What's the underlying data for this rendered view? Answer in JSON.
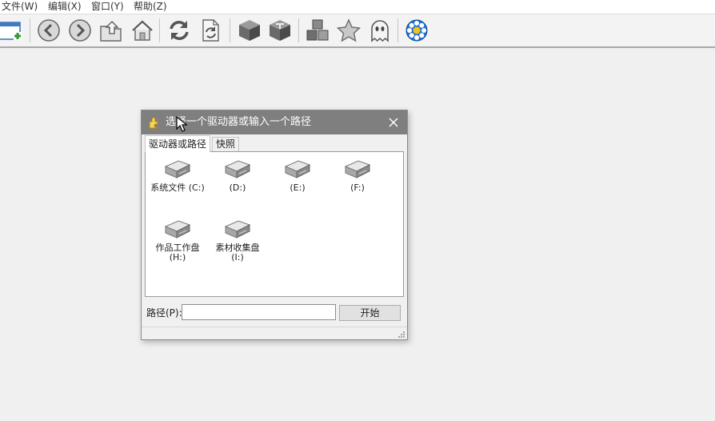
{
  "menu": [
    "文件(W)",
    "编辑(X)",
    "窗口(Y)",
    "帮助(Z)"
  ],
  "toolbar": {
    "icons": [
      "new-window-icon",
      "back-arrow-icon",
      "forward-arrow-icon",
      "folder-up-icon",
      "home-icon",
      "refresh-icon",
      "refresh-document-icon",
      "box-dark-icon",
      "box-t-icon",
      "boxes-icon",
      "star-icon",
      "ghost-icon",
      "flower-icon"
    ],
    "accent": "#1e6fd1"
  },
  "dialog": {
    "title": "选择一个驱动器或输入一个路径",
    "tabs": [
      "驱动器或路径",
      "快照"
    ],
    "drives": [
      {
        "label": "系统文件 (C:)",
        "sub": ""
      },
      {
        "label": "(D:)",
        "sub": ""
      },
      {
        "label": "(E:)",
        "sub": ""
      },
      {
        "label": "(F:)",
        "sub": ""
      },
      {
        "label": "作品工作盘",
        "sub": "(H:)"
      },
      {
        "label": "素材收集盘",
        "sub": "(I:)"
      }
    ],
    "path_label": "路径(P):",
    "path_value": "",
    "start_button": "开始",
    "titlebar_color": "#7f7f7f"
  }
}
